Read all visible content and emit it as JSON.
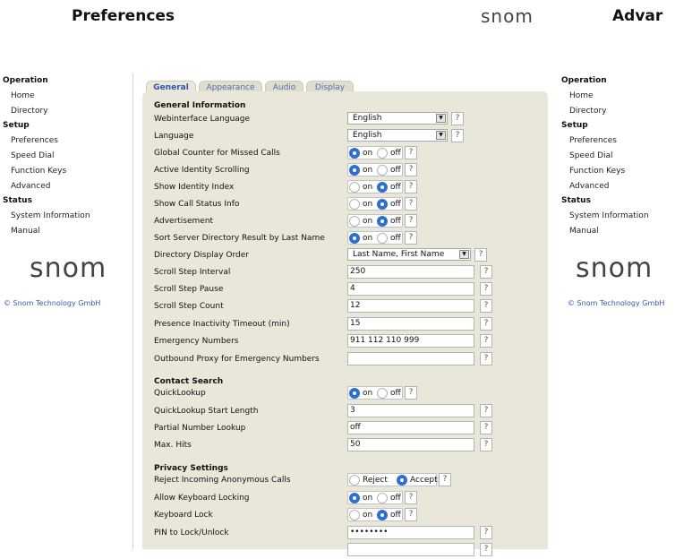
{
  "page_title": "Preferences",
  "right_title": "Advar",
  "logo_top": "snom",
  "left_nav": {
    "logo": "snom",
    "copyright": "© Snom Technology GmbH",
    "items": [
      {
        "type": "sec",
        "label": "Operation"
      },
      {
        "type": "it",
        "label": "Home"
      },
      {
        "type": "it",
        "label": "Directory"
      },
      {
        "type": "sec",
        "label": "Setup"
      },
      {
        "type": "it",
        "label": "Preferences"
      },
      {
        "type": "it",
        "label": "Speed Dial"
      },
      {
        "type": "it",
        "label": "Function Keys"
      },
      {
        "type": "it",
        "label": "Advanced"
      },
      {
        "type": "sec",
        "label": "Status"
      },
      {
        "type": "it",
        "label": "System Information"
      },
      {
        "type": "it",
        "label": "Manual"
      }
    ]
  },
  "right_nav": {
    "logo": "snom",
    "copyright": "© Snom Technology GmbH",
    "items": [
      {
        "type": "sec",
        "label": "Operation"
      },
      {
        "type": "it",
        "label": "Home"
      },
      {
        "type": "it",
        "label": "Directory"
      },
      {
        "type": "sec",
        "label": "Setup"
      },
      {
        "type": "it",
        "label": "Preferences"
      },
      {
        "type": "it",
        "label": "Speed Dial"
      },
      {
        "type": "it",
        "label": "Function Keys"
      },
      {
        "type": "it",
        "label": "Advanced"
      },
      {
        "type": "sec",
        "label": "Status"
      },
      {
        "type": "it",
        "label": "System Information"
      },
      {
        "type": "it",
        "label": "Manual"
      }
    ]
  },
  "tabs": [
    "General",
    "Appearance",
    "Audio",
    "Display"
  ],
  "active_tab": "General",
  "help_label": "?",
  "radio_on": "on",
  "radio_off": "off",
  "radio_reject": "Reject",
  "radio_accept": "Accept",
  "sections": {
    "general": "General Information",
    "contact": "Contact Search",
    "privacy": "Privacy Settings"
  },
  "rows": [
    {
      "label": "Webinterface Language",
      "kind": "select",
      "value": "English"
    },
    {
      "label": "Language",
      "kind": "select",
      "value": "English"
    },
    {
      "label": "Global Counter for Missed Calls",
      "kind": "radio",
      "value": "on"
    },
    {
      "label": "Active Identity Scrolling",
      "kind": "radio",
      "value": "on"
    },
    {
      "label": "Show Identity Index",
      "kind": "radio",
      "value": "off"
    },
    {
      "label": "Show Call Status Info",
      "kind": "radio",
      "value": "off"
    },
    {
      "label": "Advertisement",
      "kind": "radio",
      "value": "off"
    },
    {
      "label": "Sort Server Directory Result by Last Name",
      "kind": "radio",
      "value": "on"
    },
    {
      "label": "Directory Display Order",
      "kind": "select2",
      "value": "Last Name, First Name"
    },
    {
      "label": "Scroll Step Interval",
      "kind": "input",
      "value": "250"
    },
    {
      "label": "Scroll Step Pause",
      "kind": "input",
      "value": "4"
    },
    {
      "label": "Scroll Step Count",
      "kind": "input",
      "value": "12"
    },
    {
      "label": "Presence Inactivity Timeout (min)",
      "kind": "input",
      "value": "15"
    },
    {
      "label": "Emergency Numbers",
      "kind": "input",
      "value": "911 112 110 999"
    },
    {
      "label": "Outbound Proxy for Emergency Numbers",
      "kind": "input",
      "value": ""
    },
    {
      "label": "QuickLookup",
      "kind": "radio",
      "value": "on"
    },
    {
      "label": "QuickLookup Start Length",
      "kind": "input",
      "value": "3"
    },
    {
      "label": "Partial Number Lookup",
      "kind": "input",
      "value": "off"
    },
    {
      "label": "Max. Hits",
      "kind": "input",
      "value": "50"
    },
    {
      "label": "Reject Incoming Anonymous Calls",
      "kind": "radio2",
      "value": "Accept"
    },
    {
      "label": "Allow Keyboard Locking",
      "kind": "radio",
      "value": "on"
    },
    {
      "label": "Keyboard Lock",
      "kind": "radio",
      "value": "off"
    },
    {
      "label": "PIN to Lock/Unlock",
      "kind": "password",
      "value": "••••••••"
    },
    {
      "label": "",
      "kind": "input",
      "value": ""
    }
  ]
}
